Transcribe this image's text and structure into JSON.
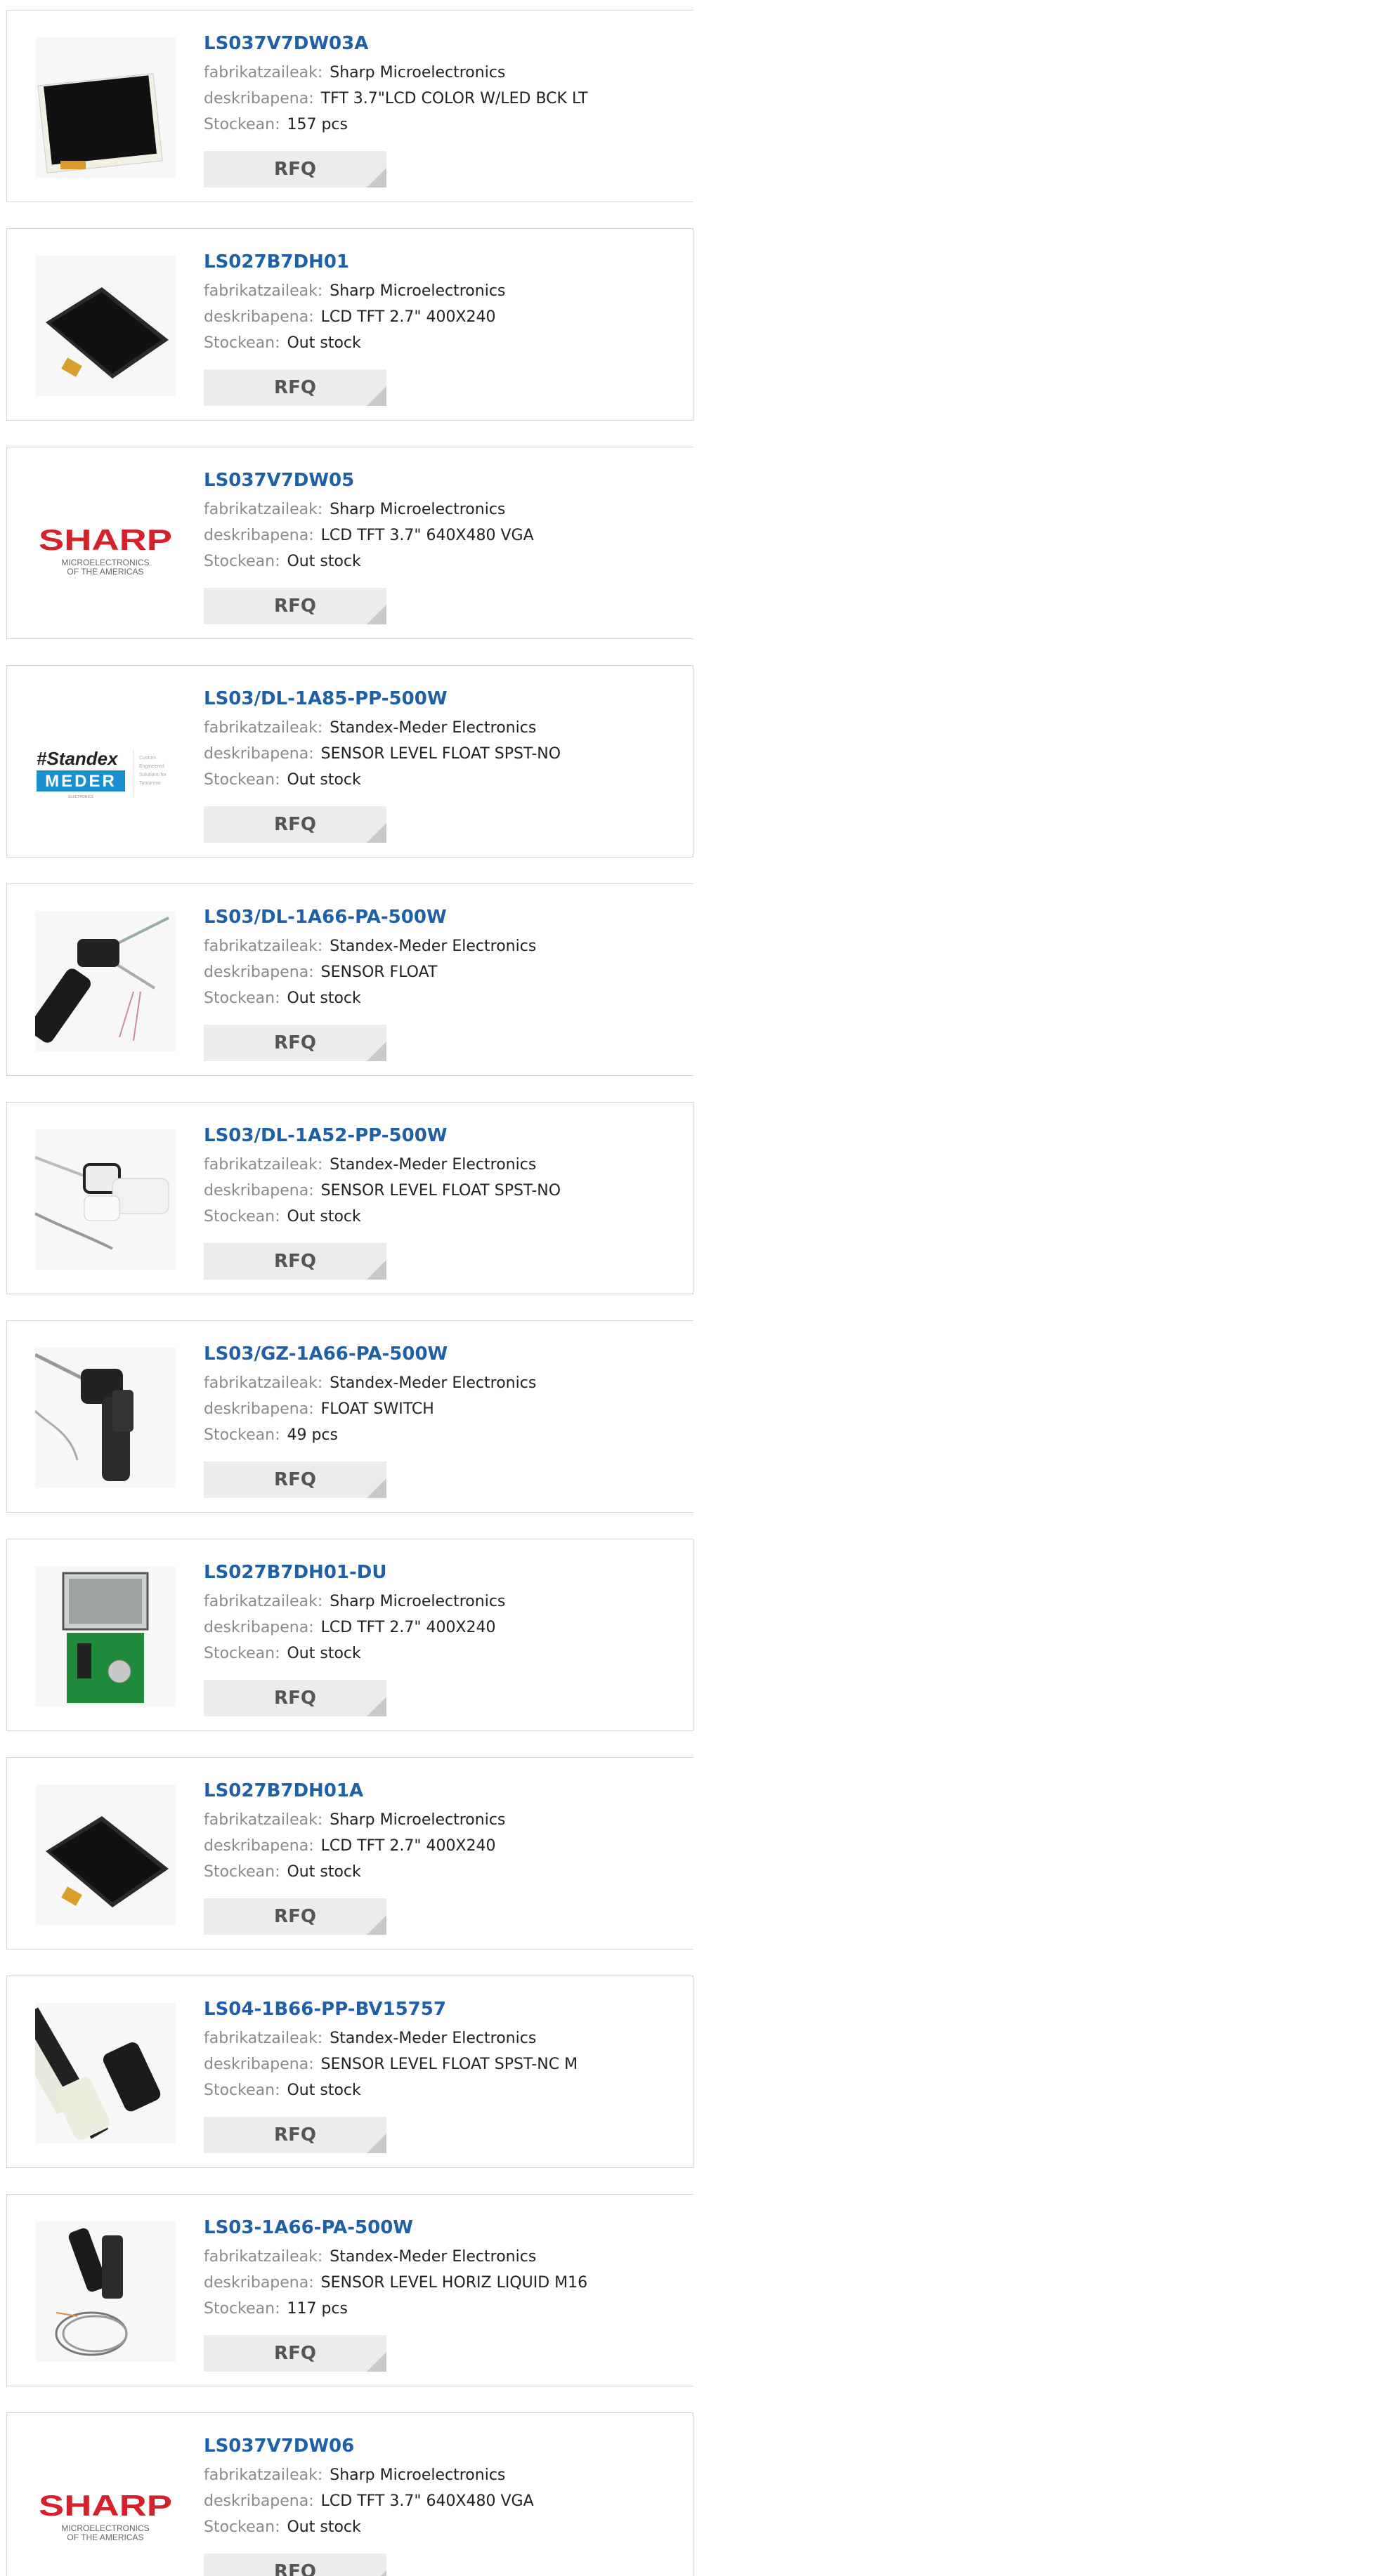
{
  "labels": {
    "manufacturer": "fabrikatzaileak:",
    "description": "deskribapena:",
    "stock": "Stockean:",
    "rfq": "RFQ"
  },
  "logos": {
    "sharp": {
      "brand": "SHARP",
      "line1": "MICROELECTRONICS",
      "line2": "OF THE AMERICAS",
      "color": "#d6202a"
    },
    "standex": {
      "brand": "Standex",
      "sub": "MEDER",
      "tag1": "Custom",
      "tag2": "Engineered",
      "tag3": "Solutions for",
      "tag4": "Tomorrow",
      "tag5": "ELECTRONICS",
      "color": "#1a8fd0"
    }
  },
  "products": [
    {
      "part": "LS037V7DW03A",
      "manufacturer": "Sharp Microelectronics",
      "description": "TFT 3.7\"LCD COLOR W/LED BCK LT",
      "stock": "157 pcs",
      "image": "lcd-portrait"
    },
    {
      "part": "LS027B7DH01",
      "manufacturer": "Sharp Microelectronics",
      "description": "LCD TFT 2.7\" 400X240",
      "stock": "Out stock",
      "image": "lcd-angled"
    },
    {
      "part": "LS037V7DW05",
      "manufacturer": "Sharp Microelectronics",
      "description": "LCD TFT 3.7\" 640X480 VGA",
      "stock": "Out stock",
      "image": "sharp-logo"
    },
    {
      "part": "LS03/DL-1A85-PP-500W",
      "manufacturer": "Standex-Meder Electronics",
      "description": "SENSOR LEVEL FLOAT SPST-NO",
      "stock": "Out stock",
      "image": "standex-logo"
    },
    {
      "part": "LS03/DL-1A66-PA-500W",
      "manufacturer": "Standex-Meder Electronics",
      "description": "SENSOR FLOAT",
      "stock": "Out stock",
      "image": "float-black"
    },
    {
      "part": "LS03/DL-1A52-PP-500W",
      "manufacturer": "Standex-Meder Electronics",
      "description": "SENSOR LEVEL FLOAT SPST-NO",
      "stock": "Out stock",
      "image": "float-white"
    },
    {
      "part": "LS03/GZ-1A66-PA-500W",
      "manufacturer": "Standex-Meder Electronics",
      "description": "FLOAT SWITCH",
      "stock": "49 pcs",
      "image": "float-black-vertical"
    },
    {
      "part": "LS027B7DH01-DU",
      "manufacturer": "Sharp Microelectronics",
      "description": "LCD TFT 2.7\" 400X240",
      "stock": "Out stock",
      "image": "lcd-devkit"
    },
    {
      "part": "LS027B7DH01A",
      "manufacturer": "Sharp Microelectronics",
      "description": "LCD TFT 2.7\" 400X240",
      "stock": "Out stock",
      "image": "lcd-angled"
    },
    {
      "part": "LS04-1B66-PP-BV15757",
      "manufacturer": "Standex-Meder Electronics",
      "description": "SENSOR LEVEL FLOAT SPST-NC M",
      "stock": "Out stock",
      "image": "float-pair"
    },
    {
      "part": "LS03-1A66-PA-500W",
      "manufacturer": "Standex-Meder Electronics",
      "description": "SENSOR LEVEL HORIZ LIQUID M16",
      "stock": "117 pcs",
      "image": "float-coil"
    },
    {
      "part": "LS037V7DW06",
      "manufacturer": "Sharp Microelectronics",
      "description": "LCD TFT 3.7\" 640X480 VGA",
      "stock": "Out stock",
      "image": "sharp-logo"
    }
  ]
}
